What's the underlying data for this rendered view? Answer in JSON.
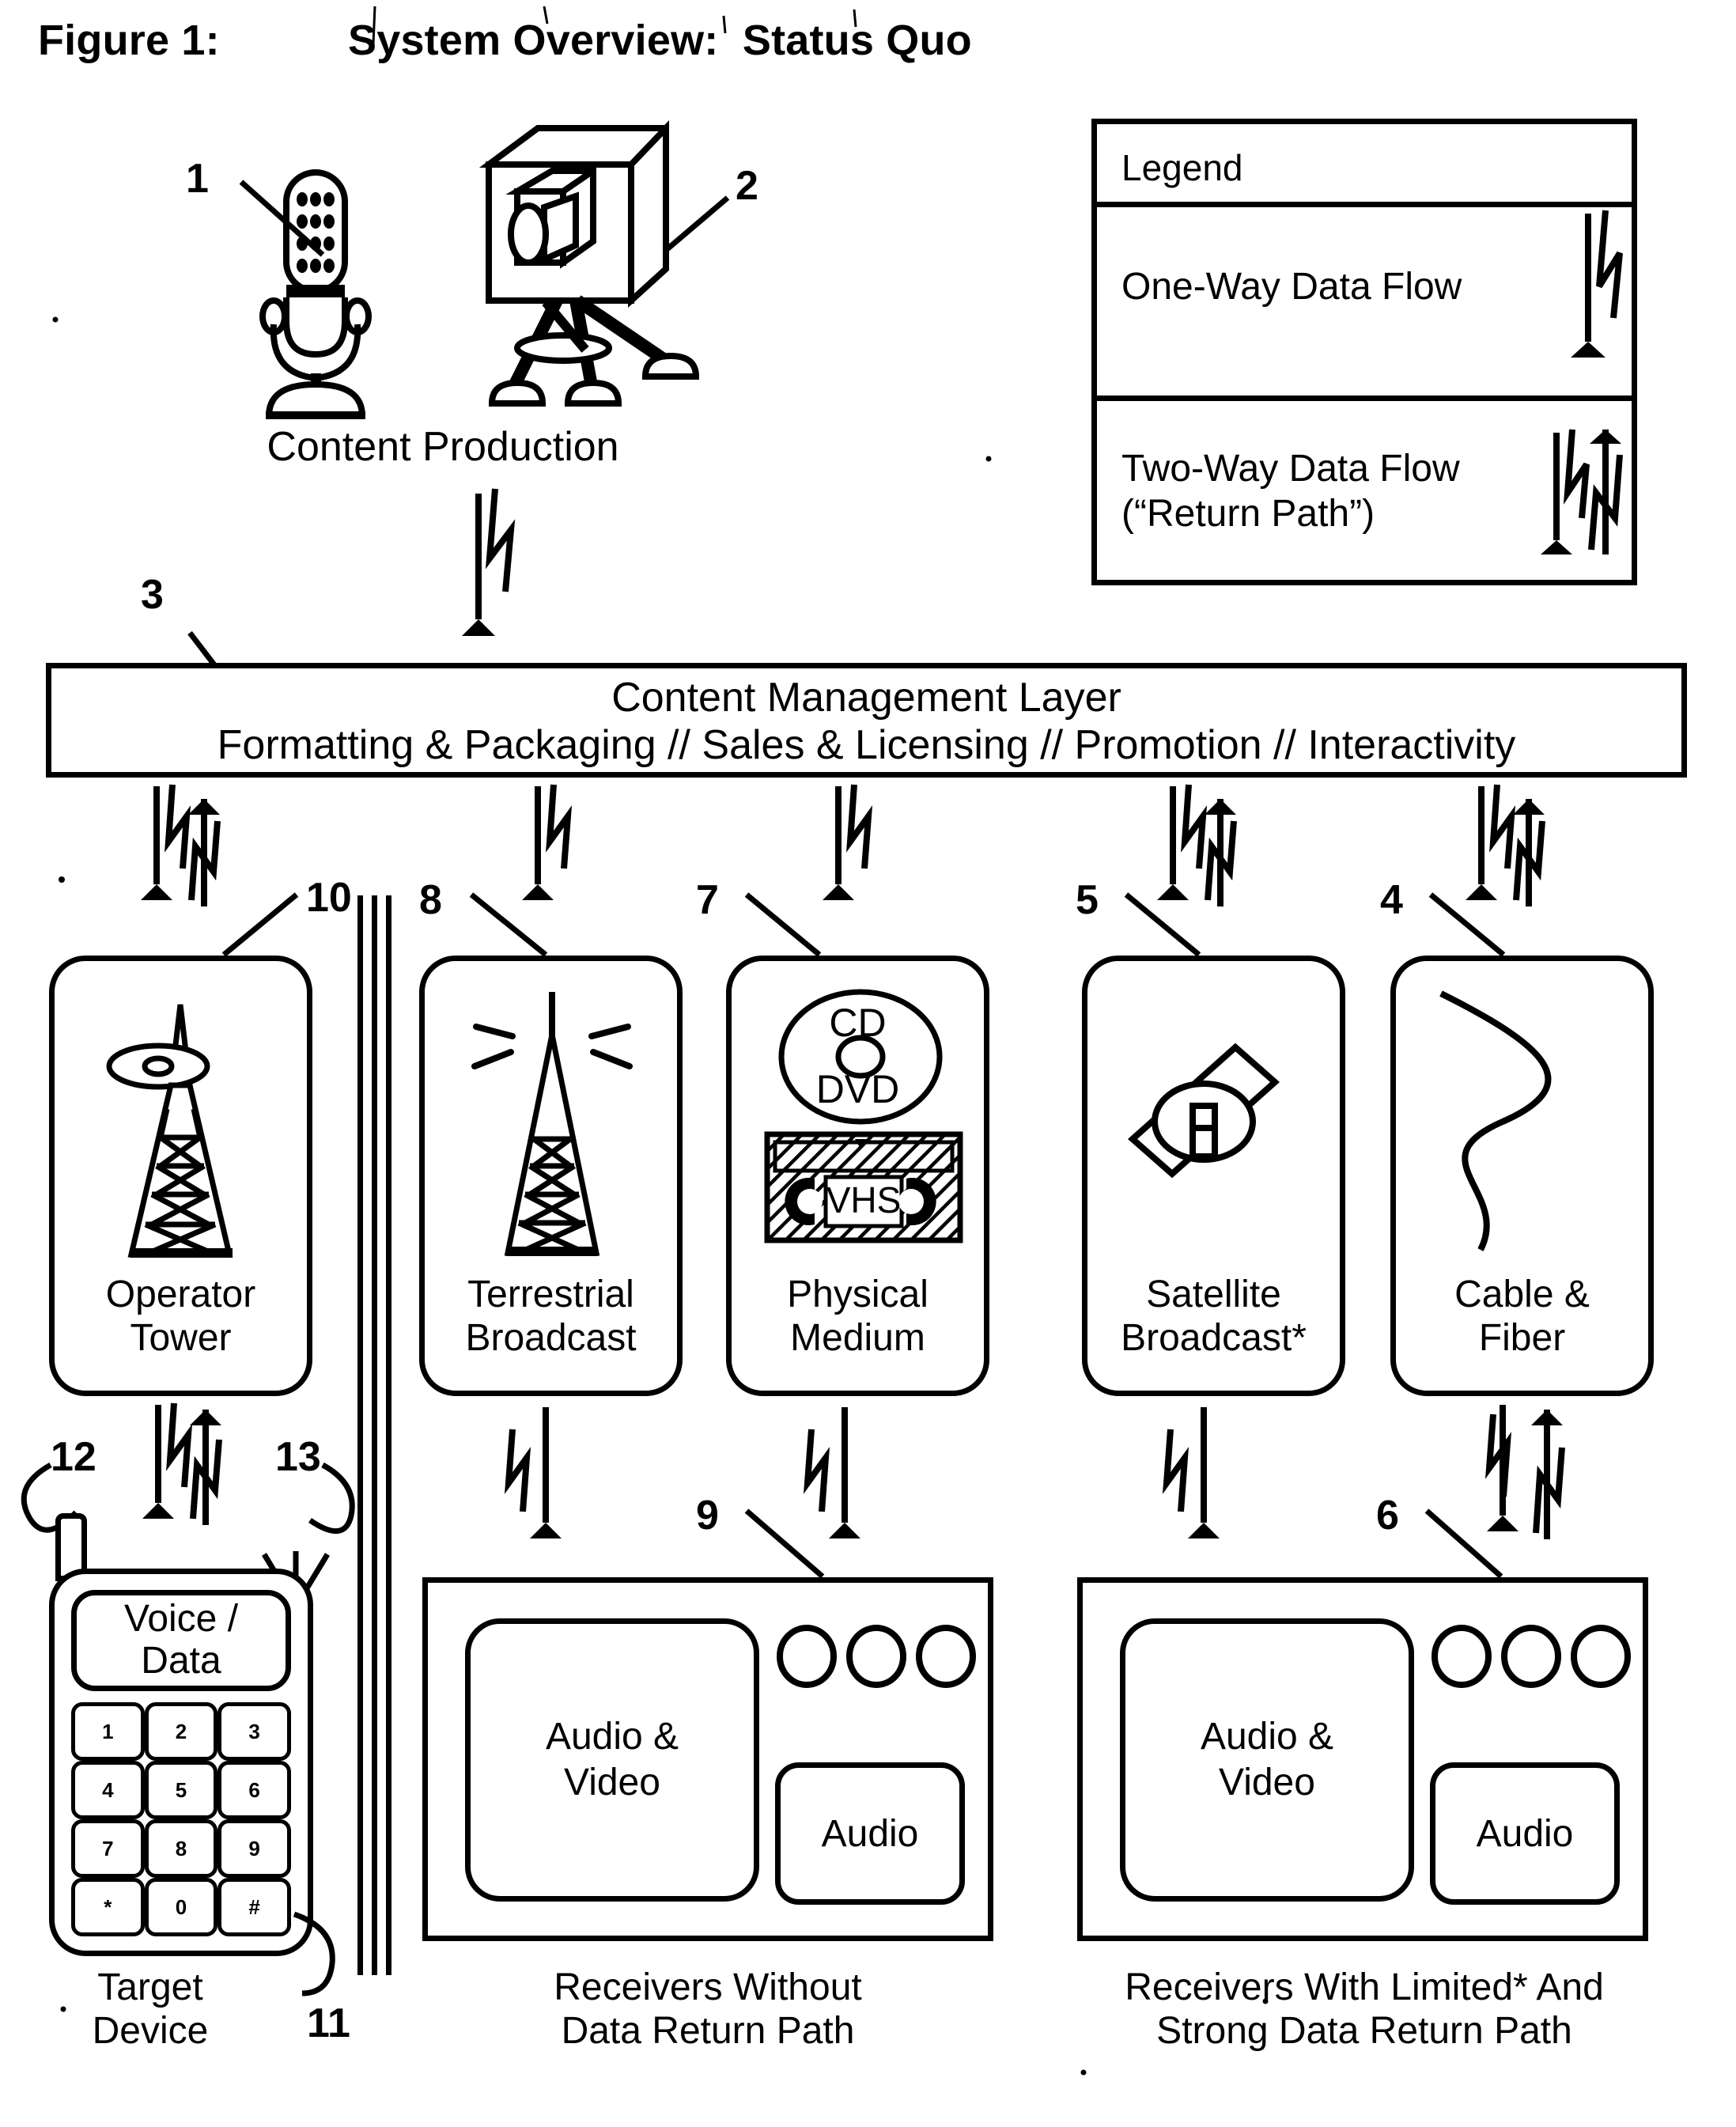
{
  "figure": {
    "label": "Figure 1:",
    "title": "System Overview:  Status Quo"
  },
  "legend": {
    "title": "Legend",
    "rows": [
      {
        "label": "One-Way Data Flow",
        "icon": "one-way-arrow-icon"
      },
      {
        "label": "Two-Way Data Flow\n(“Return Path”)",
        "icon": "two-way-arrow-icon"
      }
    ]
  },
  "content_production": {
    "caption": "Content Production",
    "microphone_ref": "1",
    "camera_ref": "2"
  },
  "content_management_layer": {
    "ref": "3",
    "line1": "Content Management Layer",
    "line2": "Formatting & Packaging  //  Sales & Licensing  //  Promotion  //  Interactivity"
  },
  "distribution": [
    {
      "ref": "10",
      "label": "Operator\nTower",
      "icon": "operator-tower-icon",
      "flow": "two-way"
    },
    {
      "ref": "8",
      "label": "Terrestrial\nBroadcast",
      "icon": "terrestrial-antenna-icon",
      "flow": "one-way"
    },
    {
      "ref": "7",
      "label": "Physical\nMedium",
      "icon": "cd-dvd-vhs-icon",
      "flow": "one-way",
      "disc_top": "CD",
      "disc_bottom": "DVD",
      "tape": "VHS"
    },
    {
      "ref": "5",
      "label": "Satellite\nBroadcast*",
      "icon": "satellite-icon",
      "flow": "two-way"
    },
    {
      "ref": "4",
      "label": "Cable &\nFiber",
      "icon": "cable-wave-icon",
      "flow": "two-way"
    }
  ],
  "target_device": {
    "ref_left": "12",
    "ref_right": "13",
    "ref_bottom": "11",
    "screen": "Voice /\nData",
    "caption": "Target\nDevice",
    "keypad": [
      [
        "1",
        "2",
        "3"
      ],
      [
        "4",
        "5",
        "6"
      ],
      [
        "7",
        "8",
        "9"
      ],
      [
        "*",
        "0",
        "#"
      ]
    ]
  },
  "receivers": [
    {
      "ref": "9",
      "screen_label": "Audio &\nVideo",
      "audio_label": "Audio",
      "caption": "Receivers Without\nData Return Path",
      "knobs": 3
    },
    {
      "ref": "6",
      "screen_label": "Audio &\nVideo",
      "audio_label": "Audio",
      "caption": "Receivers With Limited* And\nStrong Data Return Path",
      "knobs": 3
    }
  ],
  "colors": {
    "ink": "#000000",
    "paper": "#ffffff"
  }
}
